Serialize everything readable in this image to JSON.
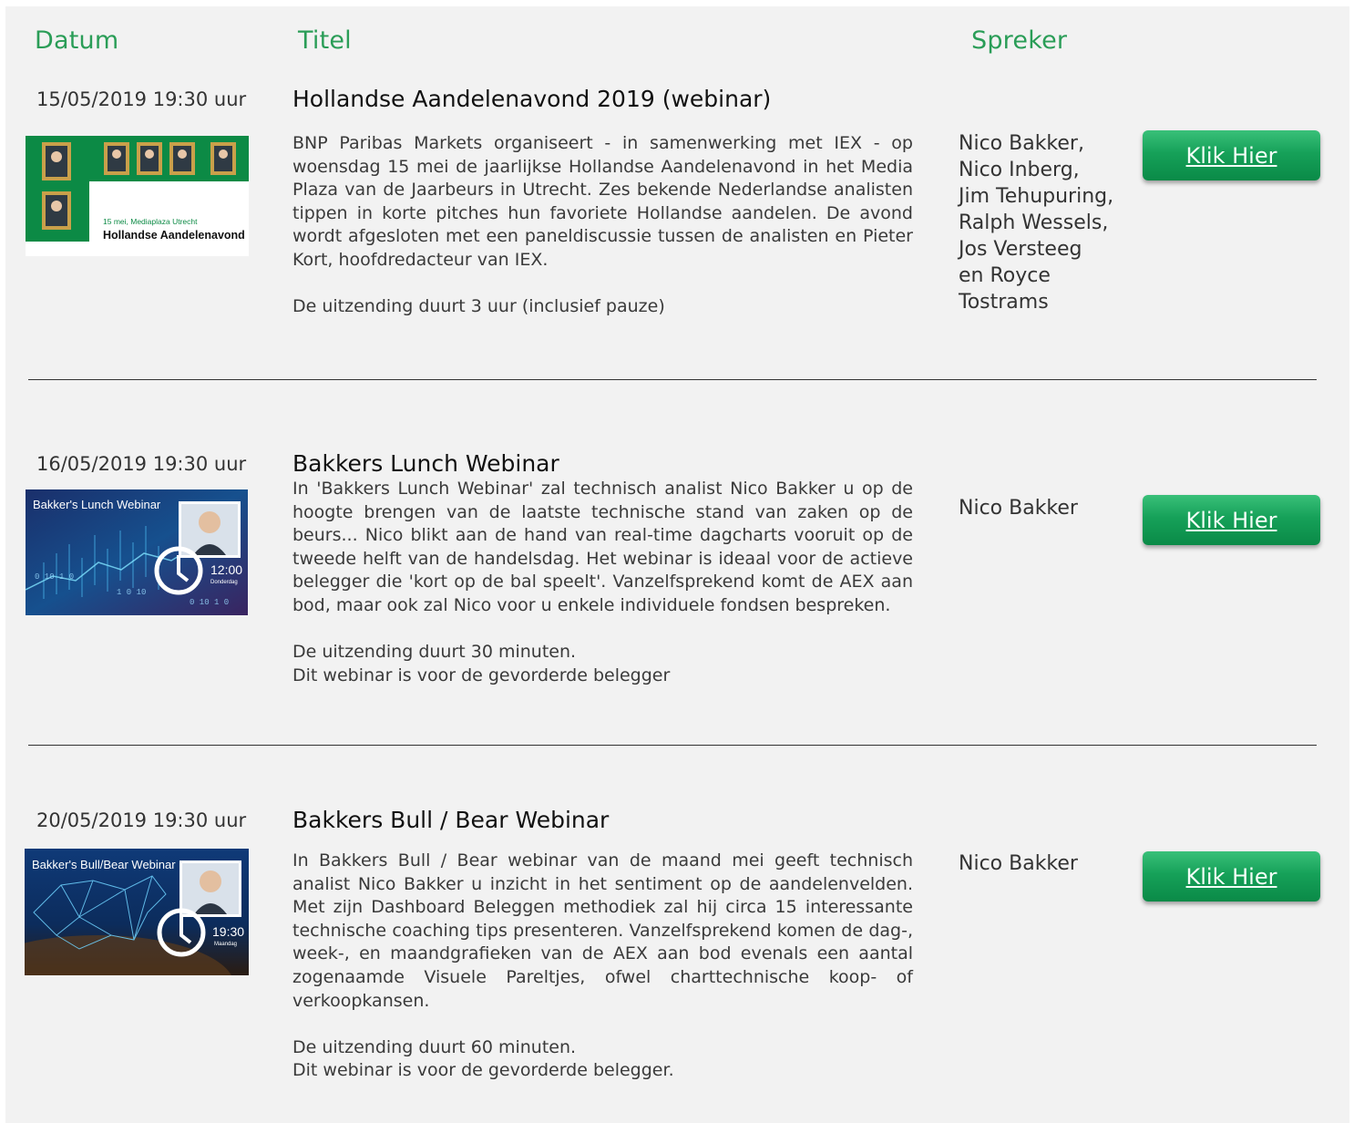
{
  "headers": {
    "date": "Datum",
    "title": "Titel",
    "speaker": "Spreker"
  },
  "button_label": "Klik Hier",
  "colors": {
    "accent": "#2a9d57",
    "button": "#16a159",
    "panel": "#f2f2f2"
  },
  "events": [
    {
      "date": "15/05/2019 19:30 uur",
      "title": "Hollandse Aandelenavond 2019 (webinar)",
      "desc1": "BNP Paribas Markets organiseert - in samenwerking met IEX - op woensdag 15 mei de jaarlijkse Hollandse Aandelenavond in het Media Plaza van de Jaarbeurs in Utrecht. Zes bekende Nederlandse analisten tippen in korte pitches hun favoriete Hollandse aandelen. De avond wordt afgesloten met een paneldiscussie tussen de analisten en Pieter Kort, hoofdredacteur van IEX.",
      "desc2": "De uitzending duurt 3 uur (inclusief pauze)",
      "desc3": "",
      "speakers": [
        "Nico Bakker,",
        "Nico Inberg,",
        "Jim Tehupuring,",
        "Ralph Wessels,",
        "Jos Versteeg",
        "en Royce",
        "Tostrams"
      ],
      "thumb": {
        "line1": "15 mei, Mediaplaza Utrecht",
        "line2": "Hollandse Aandelenavond"
      }
    },
    {
      "date": "16/05/2019 19:30 uur",
      "title": "Bakkers Lunch Webinar",
      "desc1": "In 'Bakkers Lunch Webinar' zal technisch analist Nico Bakker u op de hoogte brengen van de laatste technische stand van zaken op de beurs... Nico blikt aan de hand van real-time dagcharts vooruit op de tweede helft van de handelsdag. Het webinar is ideaal voor de actieve belegger die 'kort op de bal speelt'. Vanzelfsprekend komt de AEX aan bod, maar ook zal Nico voor u enkele individuele fondsen bespreken.",
      "desc2": "De uitzending duurt 30 minuten.",
      "desc3": "Dit webinar is voor de gevorderde belegger",
      "speakers": [
        "Nico Bakker"
      ],
      "thumb": {
        "line1": "Bakker's Lunch Webinar",
        "time": "12:00",
        "day": "Donderdag"
      }
    },
    {
      "date": "20/05/2019 19:30 uur",
      "title": "Bakkers Bull / Bear Webinar",
      "desc1": "In Bakkers Bull / Bear webinar van de maand mei geeft technisch analist Nico Bakker u inzicht in het sentiment op de aandelenvelden. Met zijn Dashboard Beleggen methodiek zal hij circa 15 interessante technische coaching tips presenteren. Vanzelfsprekend komen de dag-, week-, en maandgrafieken van de AEX aan bod evenals een aantal zogenaamde Visuele Pareltjes, ofwel charttechnische koop- of verkoopkansen.",
      "desc2": "De uitzending duurt 60 minuten.",
      "desc3": "Dit webinar is voor de gevorderde belegger.",
      "speakers": [
        "Nico Bakker"
      ],
      "thumb": {
        "line1": "Bakker's Bull/Bear Webinar",
        "time": "19:30",
        "day": "Maandag"
      }
    }
  ]
}
